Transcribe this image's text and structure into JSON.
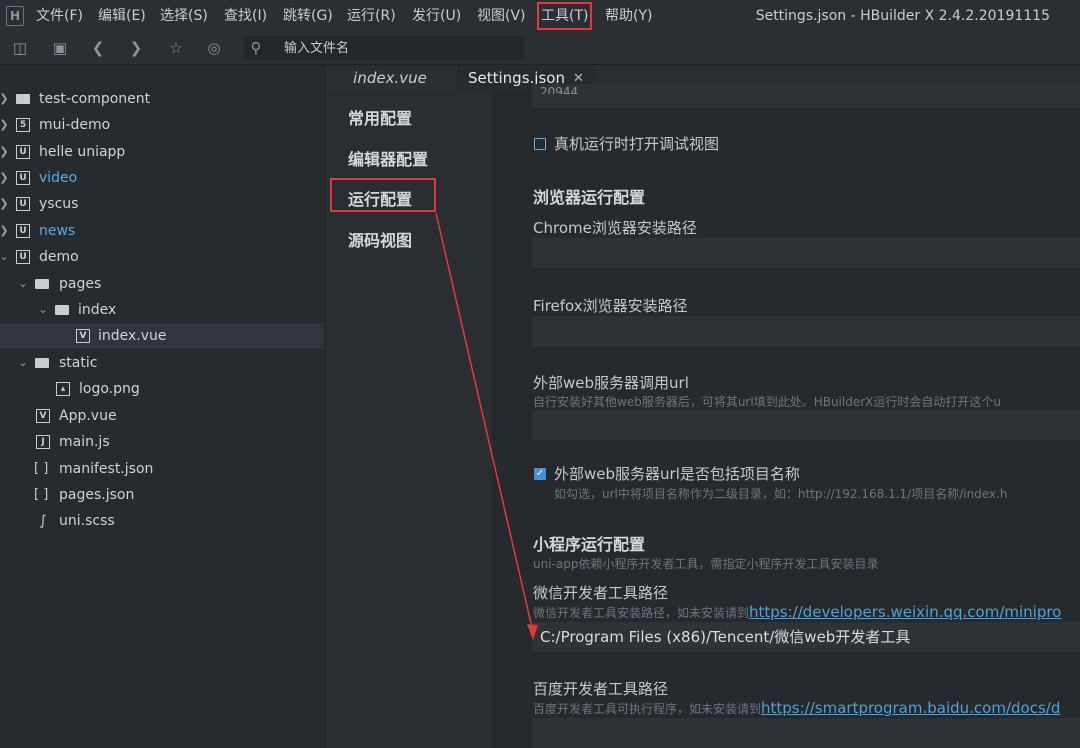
{
  "menubar": {
    "items": [
      "文件(F)",
      "编辑(E)",
      "选择(S)",
      "查找(I)",
      "跳转(G)",
      "运行(R)",
      "发行(U)",
      "视图(V)",
      "工具(T)",
      "帮助(Y)"
    ],
    "window_title": "Settings.json - HBuilder X 2.4.2.20191115"
  },
  "toolbar": {
    "file_search_placeholder": "输入文件名"
  },
  "sidebar": {
    "items": [
      {
        "label": "test-component",
        "icon": "folder-doc-icon"
      },
      {
        "label": "mui-demo",
        "icon": "project-icon"
      },
      {
        "label": "helle uniapp",
        "icon": "uniapp-project-icon"
      },
      {
        "label": "video",
        "icon": "uniapp-project-icon"
      },
      {
        "label": "yscus",
        "icon": "uniapp-project-icon"
      },
      {
        "label": "news",
        "icon": "uniapp-project-icon"
      },
      {
        "label": "demo",
        "icon": "uniapp-project-icon"
      },
      {
        "label": "pages",
        "icon": "folder-icon"
      },
      {
        "label": "index",
        "icon": "folder-icon"
      },
      {
        "label": "index.vue",
        "icon": "vue-file-icon"
      },
      {
        "label": "static",
        "icon": "folder-icon"
      },
      {
        "label": "logo.png",
        "icon": "image-file-icon"
      },
      {
        "label": "App.vue",
        "icon": "vue-file-icon"
      },
      {
        "label": "main.js",
        "icon": "js-file-icon"
      },
      {
        "label": "manifest.json",
        "icon": "json-file-icon"
      },
      {
        "label": "pages.json",
        "icon": "json-file-icon"
      },
      {
        "label": "uni.scss",
        "icon": "scss-file-icon"
      }
    ]
  },
  "tabs": {
    "index": "index.vue",
    "settings": "Settings.json"
  },
  "settings_nav": {
    "items": [
      "常用配置",
      "编辑器配置",
      "运行配置",
      "源码视图"
    ]
  },
  "settings": {
    "partial_value": "20944",
    "debug_view_label": "真机运行时打开调试视图",
    "browser_section": "浏览器运行配置",
    "chrome_label": "Chrome浏览器安装路径",
    "firefox_label": "Firefox浏览器安装路径",
    "webserver_label": "外部web服务器调用url",
    "webserver_hint": "自行安装好其他web服务器后，可将其url填到此处。HBuilderX运行时会自动打开这个u",
    "include_name_label": "外部web服务器url是否包括项目名称",
    "include_name_hint": "如勾选，url中将项目名称作为二级目录，如：http://192.168.1.1/项目名称/index.h",
    "miniprogram_section": "小程序运行配置",
    "miniprogram_hint": "uni-app依赖小程序开发者工具，需指定小程序开发工具安装目录",
    "wechat_label": "微信开发者工具路径",
    "wechat_hint": "微信开发者工具安装路径，如未安装请到",
    "wechat_link": "https://developers.weixin.qq.com/minipro",
    "wechat_path": "C:/Program Files (x86)/Tencent/微信web开发者工具",
    "baidu_label": "百度开发者工具路径",
    "baidu_hint": "百度开发者工具可执行程序，如未安装请到",
    "baidu_link": "https://smartprogram.baidu.com/docs/d"
  },
  "colors": {
    "accent": "#4a90d9",
    "highlight_box": "#e0393e",
    "link": "#4aa3df"
  }
}
